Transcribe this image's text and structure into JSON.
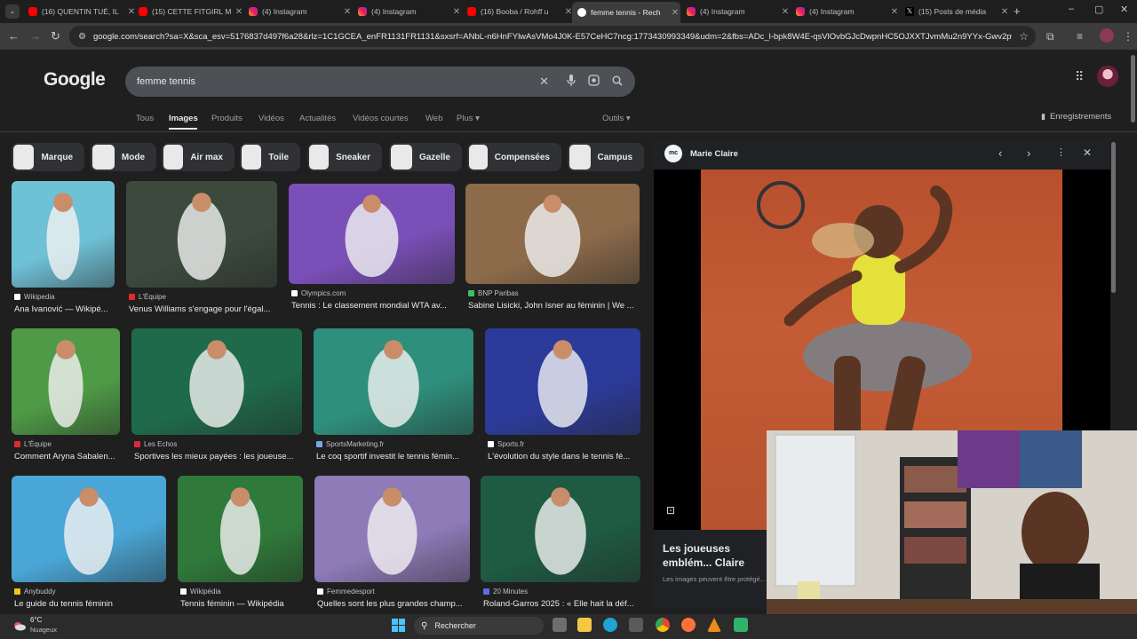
{
  "browser": {
    "tabs": [
      {
        "label": "(16) QUENTIN TUÉ, IL",
        "icon": "youtube-icon"
      },
      {
        "label": "(15) CETTE FITGIRL M",
        "icon": "youtube-icon"
      },
      {
        "label": "(4) Instagram",
        "icon": "instagram-icon"
      },
      {
        "label": "(4) Instagram",
        "icon": "instagram-icon"
      },
      {
        "label": "(16) Booba / Rohff u",
        "icon": "youtube-icon"
      },
      {
        "label": "femme tennis - Rech",
        "icon": "google-icon"
      },
      {
        "label": "(4) Instagram",
        "icon": "instagram-icon"
      },
      {
        "label": "(4) Instagram",
        "icon": "instagram-icon"
      },
      {
        "label": "(15) Posts de média",
        "icon": "x-icon"
      }
    ],
    "url": "google.com/search?sa=X&sca_esv=5176837d497f6a28&rlz=1C1GCEA_enFR1131FR1131&sxsrf=ANbL-n6HnFYlwAsVMo4J0K-E57CeHC7ncg:1773430993349&udm=2&fbs=ADc_l-bpk8W4E-qsVlOvbGJcDwpnHC5OJXXTJvmMu2n9YYx-Gwv2pwuu9X9w..."
  },
  "google": {
    "logo": "Google",
    "query": "femme tennis",
    "nav": [
      "Tous",
      "Images",
      "Produits",
      "Vidéos",
      "Actualités",
      "Vidéos courtes",
      "Web",
      "Plus ▾"
    ],
    "tools": "Outils ▾",
    "saved": "Enregistrements"
  },
  "chips": [
    "Marque",
    "Mode",
    "Air max",
    "Toile",
    "Sneaker",
    "Gazelle",
    "Compensées",
    "Campus"
  ],
  "results": [
    {
      "source": "Wikipedia",
      "title": "Ana Ivanović — Wikipé...",
      "src_color": "#ffffff",
      "bg": "#6fc1d6"
    },
    {
      "source": "L'Équipe",
      "title": "Venus Williams s'engage pour l'égal...",
      "src_color": "#e02b2b",
      "bg": "#3b4a3c"
    },
    {
      "source": "Olympics.com",
      "title": "Tennis : Le classement mondial WTA av...",
      "src_color": "#ffffff",
      "bg": "#7b4fb8"
    },
    {
      "source": "BNP Paribas",
      "title": "Sabine Lisicki, John Isner au féminin | We ...",
      "src_color": "#3fbf5f",
      "bg": "#8c6a4a"
    },
    {
      "source": "L'Équipe",
      "title": "Comment Aryna Sabalen...",
      "src_color": "#e02b2b",
      "bg": "#4f9a46"
    },
    {
      "source": "Les Echos",
      "title": "Sportives les mieux payées : les joueuse...",
      "src_color": "#e0283c",
      "bg": "#1f6a4a"
    },
    {
      "source": "SportsMarketing.fr",
      "title": "Le coq sportif investit le tennis fémin...",
      "src_color": "#7aa7e8",
      "bg": "#2e8f7c"
    },
    {
      "source": "Sports.fr",
      "title": "L'évolution du style dans le tennis fé...",
      "src_color": "#ffffff",
      "bg": "#2c3b9a"
    },
    {
      "source": "Anybuddy",
      "title": "Le guide du tennis féminin",
      "src_color": "#f1c40f",
      "bg": "#4aa6d6"
    },
    {
      "source": "Wikipédia",
      "title": "Tennis féminin — Wikipédia",
      "src_color": "#ffffff",
      "bg": "#2f7a3a"
    },
    {
      "source": "Femmedesport",
      "title": "Quelles sont les plus grandes champ...",
      "src_color": "#ffffff",
      "bg": "#8e7bb8"
    },
    {
      "source": "20 Minutes",
      "title": "Roland-Garros 2025 : « Elle hait la déf...",
      "src_color": "#5b6ee1",
      "bg": "#1f5a43"
    }
  ],
  "preview": {
    "site_logo": "mc",
    "site": "Marie Claire",
    "title": "Les joueuses emblém... Claire",
    "note": "Les images peuvent être protégé..."
  },
  "taskbar": {
    "temp": "6°C",
    "weather": "Nuageux",
    "search": "Rechercher"
  }
}
